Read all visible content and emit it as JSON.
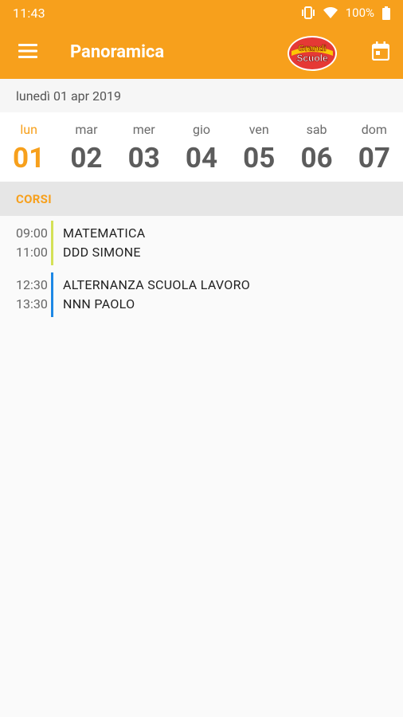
{
  "status": {
    "time": "11:43",
    "battery": "100%"
  },
  "toolbar": {
    "title": "Panoramica",
    "logo_line1": "Grandi",
    "logo_line2": "Scuole"
  },
  "date_label": "lunedì 01 apr 2019",
  "week": [
    {
      "name": "lun",
      "num": "01",
      "active": true
    },
    {
      "name": "mar",
      "num": "02",
      "active": false
    },
    {
      "name": "mer",
      "num": "03",
      "active": false
    },
    {
      "name": "gio",
      "num": "04",
      "active": false
    },
    {
      "name": "ven",
      "num": "05",
      "active": false
    },
    {
      "name": "sab",
      "num": "06",
      "active": false
    },
    {
      "name": "dom",
      "num": "07",
      "active": false
    }
  ],
  "section": {
    "title": "CORSI"
  },
  "courses": [
    {
      "start": "09:00",
      "end": "11:00",
      "subject": "MATEMATICA",
      "teacher": "DDD SIMONE",
      "color": "#d4e157"
    },
    {
      "start": "12:30",
      "end": "13:30",
      "subject": "ALTERNANZA SCUOLA LAVORO",
      "teacher": "NNN PAOLO",
      "color": "#1e88e5"
    }
  ],
  "colors": {
    "accent": "#f7a01c"
  }
}
